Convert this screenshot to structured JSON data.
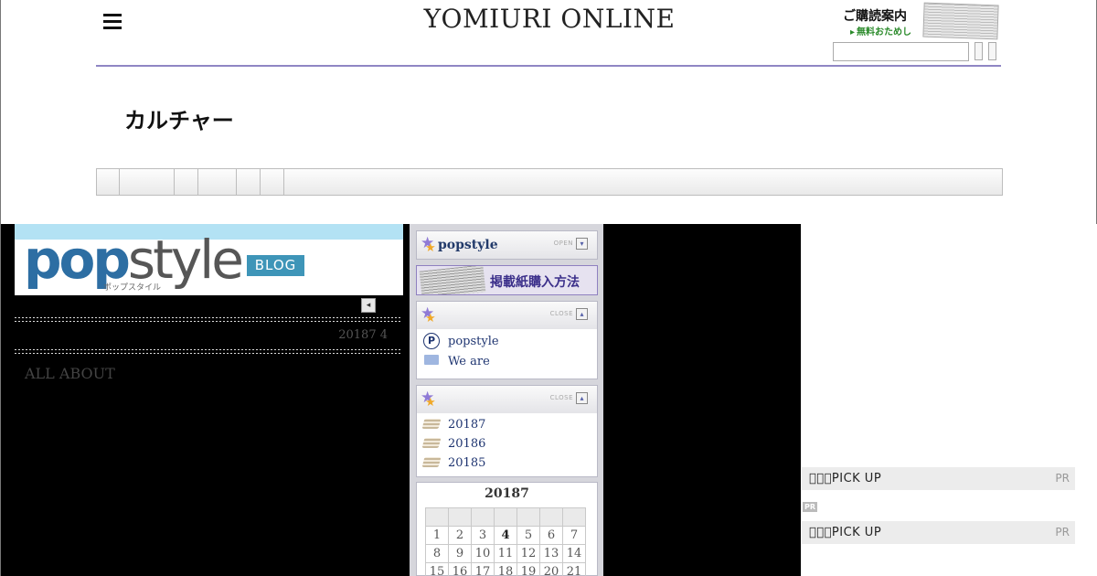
{
  "header": {
    "logo": "YOMIURI ONLINE",
    "promo_title": "ご購読案内",
    "promo_sub": "無料おためし",
    "search_value": ""
  },
  "section_title": "カルチャー",
  "blog": {
    "banner_pop": "pop",
    "banner_style": "style",
    "banner_badge": "BLOG",
    "banner_kana": "ポップスタイル",
    "prev_label": "◂",
    "date_label": "20187 4",
    "category_label": "ALL ABOUT"
  },
  "sidebar": {
    "top_widget": {
      "title": "popstyle",
      "toggle_label": "OPEN",
      "toggle_icon": "▾"
    },
    "buy_banner": "掲載紙購入方法",
    "links_widget": {
      "toggle_label": "CLOSE",
      "toggle_icon": "▴",
      "items": [
        {
          "label": "popstyle",
          "icon": "p-circle-icon"
        },
        {
          "label": "We are",
          "icon": "folder-icon"
        }
      ]
    },
    "archive_widget": {
      "toggle_label": "CLOSE",
      "toggle_icon": "▴",
      "items": [
        {
          "label": "20187",
          "icon": "books-icon"
        },
        {
          "label": "20186",
          "icon": "books-icon"
        },
        {
          "label": "20185",
          "icon": "books-icon"
        }
      ]
    },
    "calendar": {
      "title": "20187",
      "rows": [
        [
          "1",
          "2",
          "3",
          "4",
          "5",
          "6",
          "7"
        ],
        [
          "8",
          "9",
          "10",
          "11",
          "12",
          "13",
          "14"
        ],
        [
          "15",
          "16",
          "17",
          "18",
          "19",
          "20",
          "21"
        ]
      ],
      "bold_day": "4"
    }
  },
  "right": {
    "pick1_title": "\u0000\u0000\u0000PICK UP",
    "pick1_pr": "PR",
    "pr_badge": "PR",
    "pick2_title": "\u0000\u0000\u0000PICK UP",
    "pick2_pr": "PR"
  },
  "colors": {
    "header_rule": "#8f86c4",
    "blog_bg": "#000000",
    "sidebar_bg": "#d6d6dc",
    "link": "#1e3470"
  }
}
